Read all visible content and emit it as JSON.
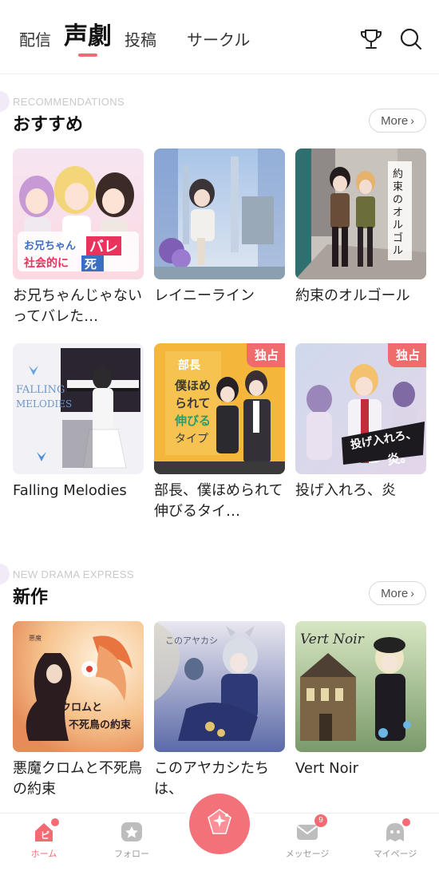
{
  "tabs": [
    {
      "label": "配信"
    },
    {
      "label": "声劇",
      "active": true
    },
    {
      "label": "投稿"
    },
    {
      "label": "サークル"
    }
  ],
  "icons": {
    "ranking": "trophy-icon",
    "search": "search-icon"
  },
  "colors": {
    "accent": "#f26b73",
    "badge": "#f06b6b",
    "muted": "#9a9a9a"
  },
  "sections": [
    {
      "en": "RECOMMENDATIONS",
      "title": "おすすめ",
      "more": "More",
      "cards": [
        {
          "title": "お兄ちゃんじゃないってバレた…"
        },
        {
          "title": "レイニーライン"
        },
        {
          "title": "約束のオルゴール",
          "cover_text": "約束のオルゴール"
        },
        {
          "title": "Falling Melodies",
          "cover_text": "FALLING MELODIES"
        },
        {
          "title": "部長、僕ほめられて伸びるタイ…",
          "badge": "独占"
        },
        {
          "title": "投げ入れろ、炎",
          "badge": "独占"
        }
      ]
    },
    {
      "en": "NEW DRAMA EXPRESS",
      "title": "新作",
      "more": "More",
      "cards": [
        {
          "title": "悪魔クロムと不死鳥の約束"
        },
        {
          "title": "このアヤカシたちは、"
        },
        {
          "title": "Vert Noir",
          "cover_text": "Vert Noir"
        }
      ]
    }
  ],
  "bottom_nav": [
    {
      "label": "ホーム",
      "icon": "home-icon",
      "active": true,
      "dot": true
    },
    {
      "label": "フォロー",
      "icon": "star-icon"
    },
    {
      "label": "",
      "icon": "gem-icon",
      "center": true
    },
    {
      "label": "メッセージ",
      "icon": "mail-icon",
      "count": "9"
    },
    {
      "label": "マイページ",
      "icon": "ghost-icon",
      "dot": true
    }
  ]
}
